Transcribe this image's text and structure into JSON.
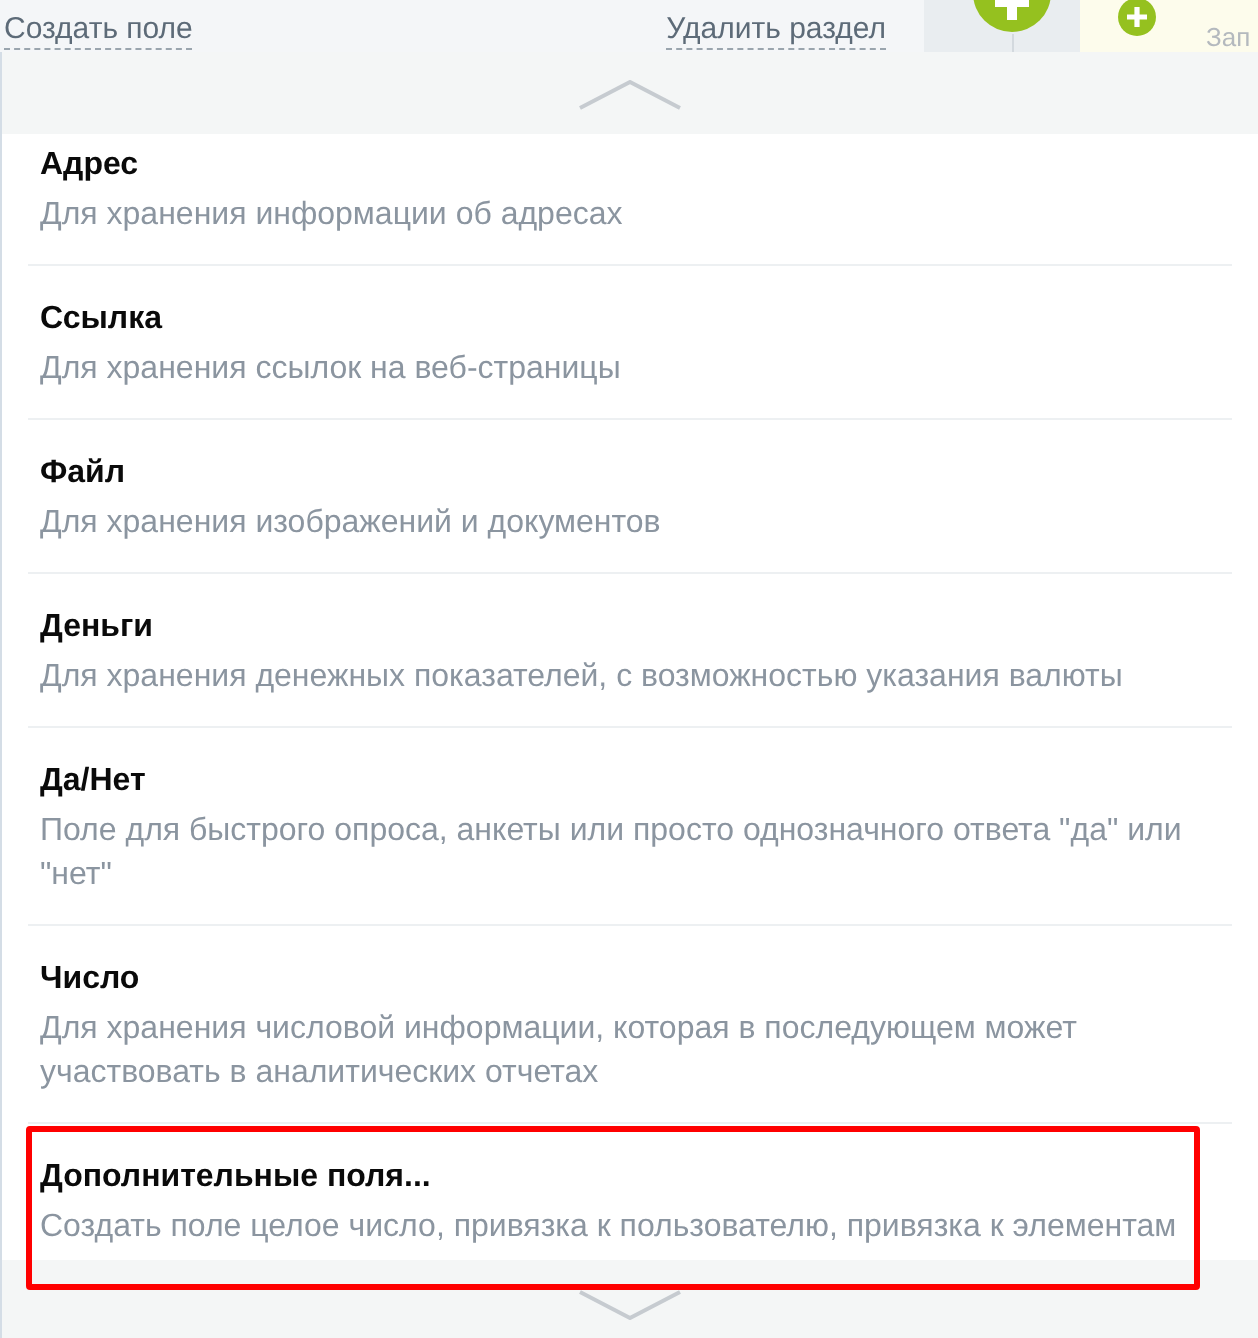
{
  "toolbar": {
    "links": [
      {
        "label": "Создать поле"
      },
      {
        "label": "Удалить раздел"
      }
    ],
    "side_label": "Зап"
  },
  "menu": {
    "items": [
      {
        "title": "Адрес",
        "description": "Для хранения информации об адресах",
        "highlighted": false
      },
      {
        "title": "Ссылка",
        "description": "Для хранения ссылок на веб-страницы",
        "highlighted": false
      },
      {
        "title": "Файл",
        "description": "Для хранения изображений и документов",
        "highlighted": false
      },
      {
        "title": "Деньги",
        "description": "Для хранения денежных показателей, с возможностью указания валюты",
        "highlighted": false
      },
      {
        "title": "Да/Нет",
        "description": "Поле для быстрого опроса, анкеты или просто однозначного ответа \"да\" или \"нет\"",
        "highlighted": false
      },
      {
        "title": "Число",
        "description": "Для хранения числовой информации, которая в последующем может участвовать в аналитических отчетах",
        "highlighted": false
      },
      {
        "title": "Дополнительные поля...",
        "description": "Создать поле целое число, привязка к пользователю, привязка к элементам",
        "highlighted": true
      }
    ]
  }
}
